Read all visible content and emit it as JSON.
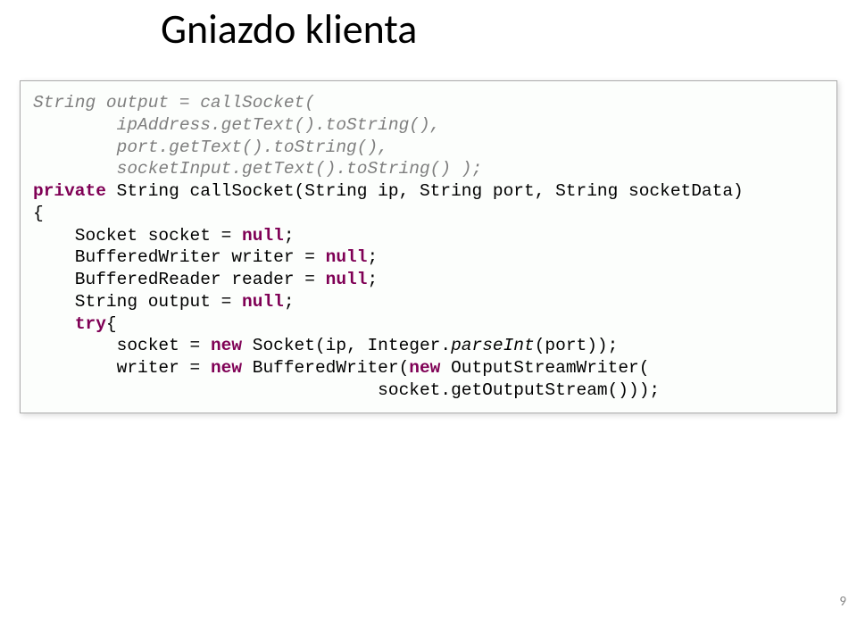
{
  "title": "Gniazdo klienta",
  "page_number": "9",
  "code": {
    "L01a": "String output = callSocket(",
    "L02a": "        ipAddress.getText().toString(),",
    "L03a": "        port.getText().toString(),",
    "L04a": "        socketInput.getText().toString() );",
    "L05_kw1": "private",
    "L05_rest": " String callSocket(String ip, String port, String socketData)",
    "L06": "{",
    "L07_pre": "    Socket socket = ",
    "L07_kw": "null",
    "L07_post": ";",
    "L08_pre": "    BufferedWriter writer = ",
    "L08_kw": "null",
    "L08_post": ";",
    "L09_pre": "    BufferedReader reader = ",
    "L09_kw": "null",
    "L09_post": ";",
    "L10_pre": "    String output = ",
    "L10_kw": "null",
    "L10_post": ";",
    "L11_pre": "    ",
    "L11_kw": "try",
    "L11_post": "{",
    "L12_pre": "        socket = ",
    "L12_kw": "new",
    "L12_post": " Socket(ip, Integer.",
    "L12_it": "parseInt",
    "L12_end": "(port));",
    "L13_pre": "        writer = ",
    "L13_kw1": "new",
    "L13_mid": " BufferedWriter(",
    "L13_kw2": "new",
    "L13_post": " OutputStreamWriter(",
    "L14": "                                 socket.getOutputStream()));"
  }
}
